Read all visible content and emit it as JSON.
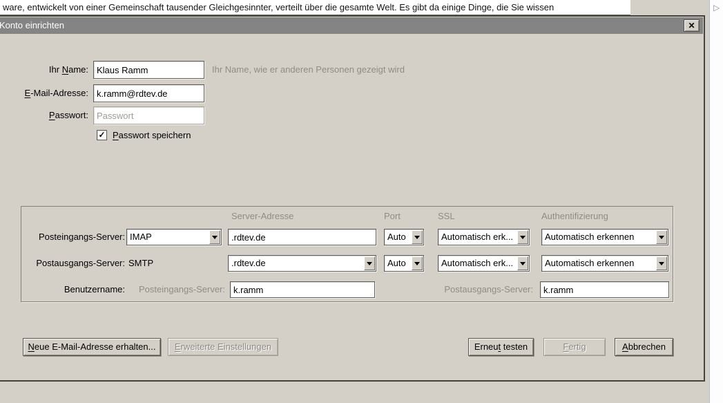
{
  "window": {
    "background_text": "ware, entwickelt von einer Gemeinschaft tausender Gleichgesinnter, verteilt über die gesamte Welt. Es gibt da einige Dinge, die Sie wissen",
    "splitter_arrow_icon": "▷"
  },
  "dialog": {
    "title": "Konto einrichten",
    "close_icon": "✕"
  },
  "identity": {
    "name_label": {
      "pre": "Ihr ",
      "accel": "N",
      "post": "ame:"
    },
    "name_value": "Klaus Ramm",
    "name_hint": "Ihr Name, wie er anderen Personen gezeigt wird",
    "email_label": {
      "pre": "",
      "accel": "E",
      "post": "-Mail-Adresse:"
    },
    "email_value": "k.ramm@rdtev.de",
    "password_label": {
      "pre": "",
      "accel": "P",
      "post": "asswort:"
    },
    "password_placeholder": "Passwort",
    "remember_password_label": {
      "pre": "",
      "accel": "P",
      "post": "asswort speichern"
    },
    "remember_password_checked": true,
    "check_icon": "✓"
  },
  "servers": {
    "column_headers": {
      "address": "Server-Adresse",
      "port": "Port",
      "ssl": "SSL",
      "auth": "Authentifizierung"
    },
    "incoming": {
      "label": "Posteingangs-Server:",
      "protocol": "IMAP",
      "address": ".rdtev.de",
      "port": "Auto",
      "ssl": "Automatisch erk...",
      "auth": "Automatisch erkennen"
    },
    "outgoing": {
      "label": "Postausgangs-Server:",
      "protocol": "SMTP",
      "address": ".rdtev.de",
      "port": "Auto",
      "ssl": "Automatisch erk...",
      "auth": "Automatisch erkennen"
    },
    "username": {
      "label": "Benutzername:",
      "incoming_label": "Posteingangs-Server:",
      "incoming_value": "k.ramm",
      "outgoing_label": "Postausgangs-Server:",
      "outgoing_value": "k.ramm"
    }
  },
  "buttons": {
    "get_new_address": {
      "pre": "",
      "accel": "N",
      "post": "eue E-Mail-Adresse erhalten..."
    },
    "advanced_settings": {
      "pre": "",
      "accel": "E",
      "post": "rweiterte Einstellungen"
    },
    "retest": {
      "pre": "Erneu",
      "accel": "t",
      "post": " testen"
    },
    "done": {
      "pre": "",
      "accel": "F",
      "post": "ertig"
    },
    "cancel": {
      "pre": "",
      "accel": "A",
      "post": "bbrechen"
    }
  },
  "colors": {
    "titlebar": "#848484",
    "dialog_bg": "#d4d0c8",
    "muted_text": "#8e8c86"
  }
}
